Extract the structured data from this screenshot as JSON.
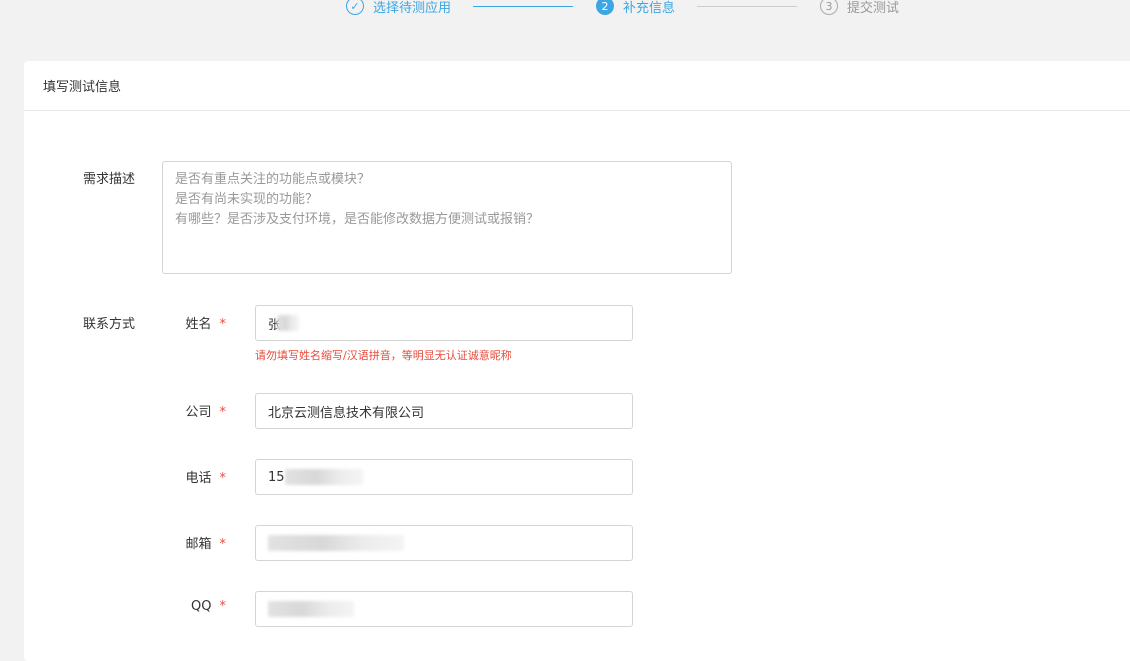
{
  "stepper": {
    "steps": [
      {
        "number": "✓",
        "label": "选择待测应用",
        "state": "done"
      },
      {
        "number": "2",
        "label": "补充信息",
        "state": "active"
      },
      {
        "number": "3",
        "label": "提交测试",
        "state": "pending"
      }
    ]
  },
  "card": {
    "title": "填写测试信息"
  },
  "requirements": {
    "label": "需求描述",
    "placeholder_lines": [
      "是否有重点关注的功能点或模块？",
      "是否有尚未实现的功能？",
      "有哪些？是否涉及支付环境，是否能修改数据方便测试或报销？"
    ]
  },
  "contact": {
    "label": "联系方式",
    "required_mark": "*",
    "name": {
      "label": "姓名",
      "value": "张",
      "hint": "请勿填写姓名缩写/汉语拼音，等明显无认证诚意昵称"
    },
    "company": {
      "label": "公司",
      "value": "北京云测信息技术有限公司"
    },
    "phone": {
      "label": "电话",
      "value": "15"
    },
    "email": {
      "label": "邮箱",
      "value": ""
    },
    "qq": {
      "label": "QQ",
      "value": ""
    }
  },
  "colors": {
    "accent": "#3da6e3",
    "required": "#e74c3c",
    "background": "#f2f2f2"
  }
}
